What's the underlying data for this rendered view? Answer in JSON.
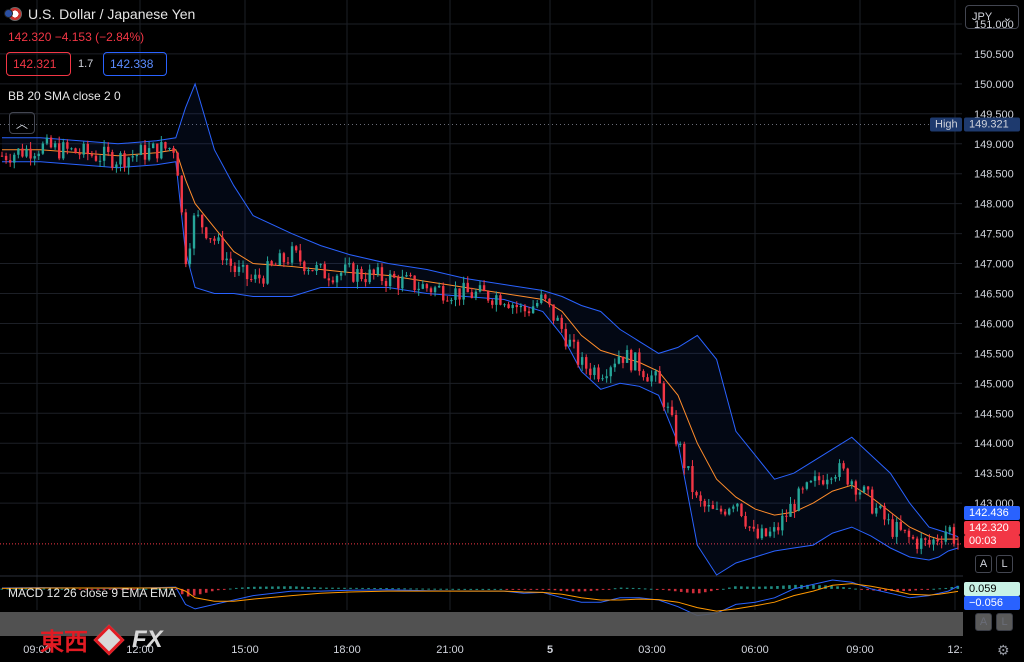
{
  "header": {
    "symbol": "U.S. Dollar / Japanese Yen",
    "price_line": "142.320  −4.153 (−2.84%)",
    "sell_price": "142.321",
    "spread": "1.7",
    "buy_price": "142.338",
    "indicator_label": "BB 20 SMA close 2 0",
    "collapse_icon": "chevron-up-icon",
    "currency": "JPY",
    "currency_icon": "chevron-down-icon"
  },
  "macd_label": "MACD 12 26 close 9 EMA EMA",
  "auto_label": "A",
  "log_label": "L",
  "logo": {
    "text": "東西",
    "fx": "FX"
  },
  "settings_icon": "gear-icon",
  "colors": {
    "up": "#26a69a",
    "down": "#f23645",
    "bb_band": "#2962ff",
    "bb_basis": "#ff8c2b",
    "macd_line": "#2962ff",
    "signal_line": "#ff9800",
    "high_tag": "#1e3a6e"
  },
  "chart_data": {
    "type": "line",
    "title": "U.S. Dollar / Japanese Yen",
    "y_axis": {
      "ylim": [
        141.8,
        151.4
      ],
      "ticks": [
        "151.000",
        "150.500",
        "150.000",
        "149.500",
        "149.000",
        "148.500",
        "148.000",
        "147.500",
        "147.000",
        "146.500",
        "146.000",
        "145.500",
        "145.000",
        "144.500",
        "144.000",
        "143.500",
        "143.000"
      ]
    },
    "x_axis": {
      "ticks": [
        "09:00",
        "12:00",
        "15:00",
        "18:00",
        "21:00",
        "5",
        "03:00",
        "06:00",
        "09:00",
        "12:"
      ]
    },
    "tags": {
      "high_label": "High",
      "high_value": "149.321",
      "upper_band_value": "142.436",
      "last_price": "142.320",
      "countdown": "00:03",
      "macd_value": "0.059",
      "signal_value": "−0.056"
    },
    "series": [
      {
        "name": "close",
        "x": [
          0,
          4,
          8,
          12,
          16,
          18,
          19,
          20,
          22,
          24,
          26,
          30,
          33,
          36,
          40,
          44,
          48,
          52,
          54,
          56,
          58,
          60,
          62,
          64,
          66,
          68,
          70,
          72,
          74,
          76,
          78,
          80,
          82,
          84,
          86,
          88,
          90,
          92,
          94,
          96,
          97,
          98,
          99
        ],
        "values": [
          148.8,
          148.95,
          148.85,
          148.75,
          148.9,
          148.95,
          147.1,
          147.8,
          147.4,
          146.9,
          146.7,
          147.15,
          146.85,
          146.85,
          146.75,
          146.6,
          146.5,
          146.45,
          146.2,
          146.4,
          145.9,
          145.3,
          145.2,
          145.5,
          145.3,
          145.0,
          144.0,
          143.0,
          142.8,
          143.1,
          142.4,
          142.5,
          143.0,
          143.3,
          143.6,
          143.4,
          143.0,
          142.6,
          142.4,
          142.3,
          142.45,
          142.6,
          142.32
        ]
      },
      {
        "name": "bb_basis",
        "values": [
          148.9,
          148.9,
          148.85,
          148.8,
          148.85,
          148.9,
          148.4,
          148.0,
          147.6,
          147.2,
          147.0,
          146.95,
          146.9,
          146.85,
          146.8,
          146.7,
          146.6,
          146.5,
          146.45,
          146.4,
          146.2,
          145.8,
          145.55,
          145.45,
          145.35,
          145.2,
          144.8,
          144.0,
          143.4,
          143.1,
          142.9,
          142.8,
          142.85,
          143.0,
          143.2,
          143.3,
          143.1,
          142.85,
          142.6,
          142.45,
          142.4,
          142.4,
          142.4
        ]
      },
      {
        "name": "bb_upper",
        "values": [
          149.1,
          149.1,
          149.05,
          149.0,
          149.05,
          149.1,
          149.6,
          150.0,
          148.9,
          148.3,
          147.8,
          147.5,
          147.3,
          147.15,
          147.0,
          146.9,
          146.75,
          146.65,
          146.6,
          146.55,
          146.45,
          146.3,
          146.2,
          145.9,
          145.7,
          145.5,
          145.6,
          145.8,
          145.4,
          144.2,
          143.8,
          143.4,
          143.5,
          143.7,
          143.9,
          144.1,
          143.8,
          143.5,
          143.0,
          142.6,
          142.55,
          142.5,
          142.44
        ]
      },
      {
        "name": "bb_lower",
        "values": [
          148.7,
          148.7,
          148.65,
          148.6,
          148.65,
          148.7,
          147.2,
          146.6,
          146.5,
          146.5,
          146.45,
          146.45,
          146.6,
          146.6,
          146.6,
          146.5,
          146.45,
          146.4,
          146.3,
          146.2,
          145.8,
          145.2,
          144.9,
          145.0,
          144.95,
          144.8,
          144.0,
          142.3,
          141.8,
          142.0,
          142.1,
          142.2,
          142.25,
          142.3,
          142.5,
          142.6,
          142.45,
          142.25,
          142.1,
          142.05,
          142.1,
          142.2,
          142.25
        ]
      },
      {
        "name": "macd",
        "values": [
          0.02,
          0.03,
          0.02,
          0.01,
          0.03,
          0.04,
          -0.35,
          -0.45,
          -0.35,
          -0.25,
          -0.15,
          -0.05,
          -0.05,
          -0.03,
          -0.02,
          -0.04,
          -0.05,
          -0.05,
          -0.1,
          -0.08,
          -0.2,
          -0.3,
          -0.3,
          -0.2,
          -0.2,
          -0.25,
          -0.4,
          -0.6,
          -0.55,
          -0.35,
          -0.3,
          -0.2,
          0.0,
          0.1,
          0.2,
          0.15,
          0.0,
          -0.1,
          -0.2,
          -0.15,
          -0.1,
          -0.05,
          0.06
        ]
      },
      {
        "name": "signal",
        "values": [
          0.01,
          0.02,
          0.02,
          0.02,
          0.02,
          0.03,
          -0.05,
          -0.2,
          -0.28,
          -0.28,
          -0.23,
          -0.15,
          -0.1,
          -0.07,
          -0.05,
          -0.05,
          -0.05,
          -0.05,
          -0.07,
          -0.08,
          -0.12,
          -0.2,
          -0.25,
          -0.25,
          -0.23,
          -0.24,
          -0.3,
          -0.42,
          -0.5,
          -0.45,
          -0.38,
          -0.3,
          -0.15,
          -0.05,
          0.08,
          0.12,
          0.06,
          -0.02,
          -0.12,
          -0.14,
          -0.12,
          -0.09,
          -0.056
        ]
      }
    ]
  }
}
